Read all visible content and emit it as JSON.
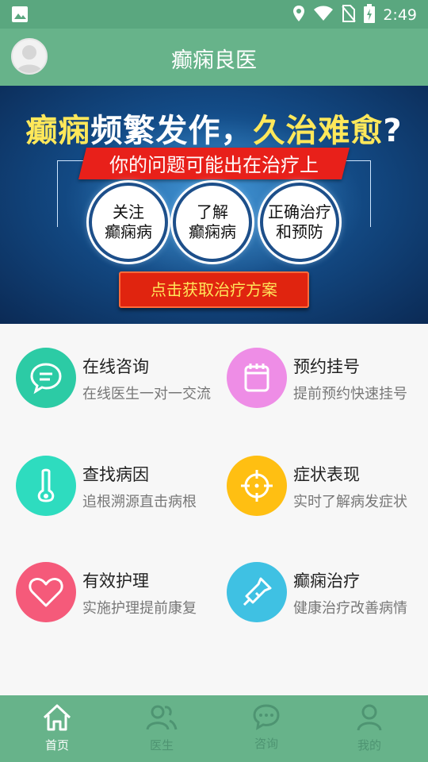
{
  "status_bar": {
    "time": "2:49",
    "icons": [
      "image-icon",
      "location-icon",
      "wifi-icon",
      "no-sim-icon",
      "battery-charging-icon"
    ]
  },
  "app": {
    "title": "癫痫良医",
    "avatar_icon": "user-avatar"
  },
  "banner": {
    "headline_part1": "癫痫",
    "headline_part2": "频繁发作，",
    "headline_part3": "久治难愈",
    "headline_part4": "?",
    "subheading": "你的问题可能出在治疗上",
    "circles": [
      {
        "line1": "关注",
        "line2": "癫痫病"
      },
      {
        "line1": "了解",
        "line2": "癫痫病"
      },
      {
        "line1": "正确治疗",
        "line2": "和预防"
      }
    ],
    "cta_label": "点击获取治疗方案"
  },
  "features": [
    {
      "title": "在线咨询",
      "subtitle": "在线医生一对一交流",
      "icon": "chat-icon",
      "color": "#2ccba5"
    },
    {
      "title": "预约挂号",
      "subtitle": "提前预约快速挂号",
      "icon": "calendar-icon",
      "color": "#ee8de6"
    },
    {
      "title": "查找病因",
      "subtitle": "追根溯源直击病根",
      "icon": "thermometer-icon",
      "color": "#2edcbf"
    },
    {
      "title": "症状表现",
      "subtitle": "实时了解病发症状",
      "icon": "crosshair-icon",
      "color": "#ffbf12"
    },
    {
      "title": "有效护理",
      "subtitle": "实施护理提前康复",
      "icon": "heart-icon",
      "color": "#f55a7a"
    },
    {
      "title": "癫痫治疗",
      "subtitle": "健康治疗改善病情",
      "icon": "flashlight-icon",
      "color": "#3fc1e3"
    }
  ],
  "bottom_nav": [
    {
      "label": "首页",
      "icon": "home-icon",
      "active": true
    },
    {
      "label": "医生",
      "icon": "doctors-icon",
      "active": false
    },
    {
      "label": "咨询",
      "icon": "chat-bubble-icon",
      "active": false
    },
    {
      "label": "我的",
      "icon": "profile-icon",
      "active": false
    }
  ],
  "colors": {
    "header": "#67b38a",
    "status_bar": "#5aa77f",
    "cta": "#e0240f",
    "highlight": "#ffe85a"
  }
}
